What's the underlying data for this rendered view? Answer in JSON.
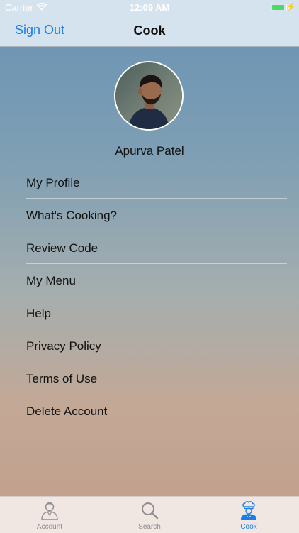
{
  "status_bar": {
    "carrier": "Carrier",
    "time": "12:09 AM",
    "battery_level": 0.85,
    "battery_color": "#4cd964"
  },
  "nav": {
    "left_button": "Sign Out",
    "title": "Cook",
    "accent_color": "#1a7ee6"
  },
  "profile": {
    "name": "Apurva Patel",
    "avatar_icon": "user-photo"
  },
  "menu": {
    "items": [
      {
        "label": "My Profile"
      },
      {
        "label": "What's Cooking?"
      },
      {
        "label": "Review Code"
      },
      {
        "label": "My Menu"
      },
      {
        "label": "Help"
      },
      {
        "label": "Privacy Policy"
      },
      {
        "label": "Terms of Use"
      },
      {
        "label": "Delete Account"
      }
    ]
  },
  "tab_bar": {
    "tabs": [
      {
        "label": "Account",
        "icon": "person-icon",
        "selected": false
      },
      {
        "label": "Search",
        "icon": "search-icon",
        "selected": false
      },
      {
        "label": "Cook",
        "icon": "chef-icon",
        "selected": true
      }
    ]
  }
}
